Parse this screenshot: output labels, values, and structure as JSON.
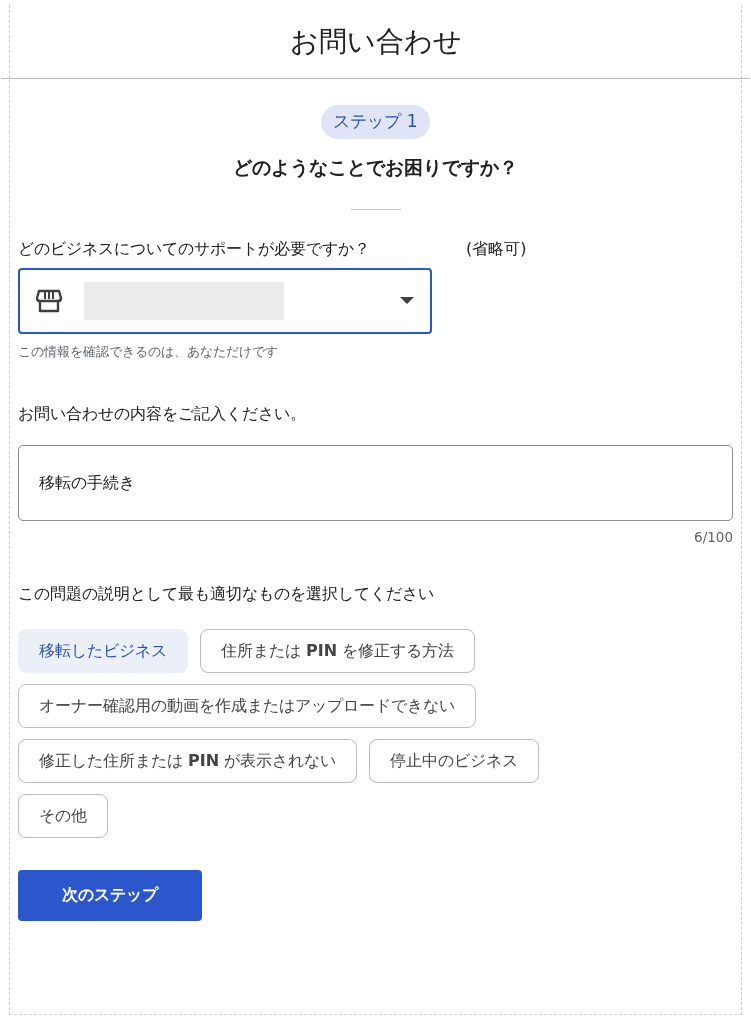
{
  "window": {
    "title": "お問い合わせ"
  },
  "step_badge": "ステップ 1",
  "heading": "どのようなことでお困りですか？",
  "business_field": {
    "label": "どのビジネスについてのサポートが必要ですか？",
    "optional": "(省略可)",
    "value_redacted": true,
    "focused": true,
    "helper": "この情報を確認できるのは、あなただけです"
  },
  "details_field": {
    "label": "お問い合わせの内容をご記入ください。",
    "value": "移転の手続き",
    "counter": "6/100"
  },
  "issue_question": "この問題の説明として最も適切なものを選択してください",
  "issue_options": [
    {
      "label": "移転したビジネス",
      "selected": true
    },
    {
      "label": "住所または **PIN** を修正する方法",
      "selected": false
    },
    {
      "label": "オーナー確認用の動画を作成またはアップロードできない",
      "selected": false
    },
    {
      "label": "修正した住所または **PIN** が表示されない",
      "selected": false
    },
    {
      "label": "停止中のビジネス",
      "selected": false
    },
    {
      "label": "その他",
      "selected": false
    }
  ],
  "next_button": "次のステップ"
}
